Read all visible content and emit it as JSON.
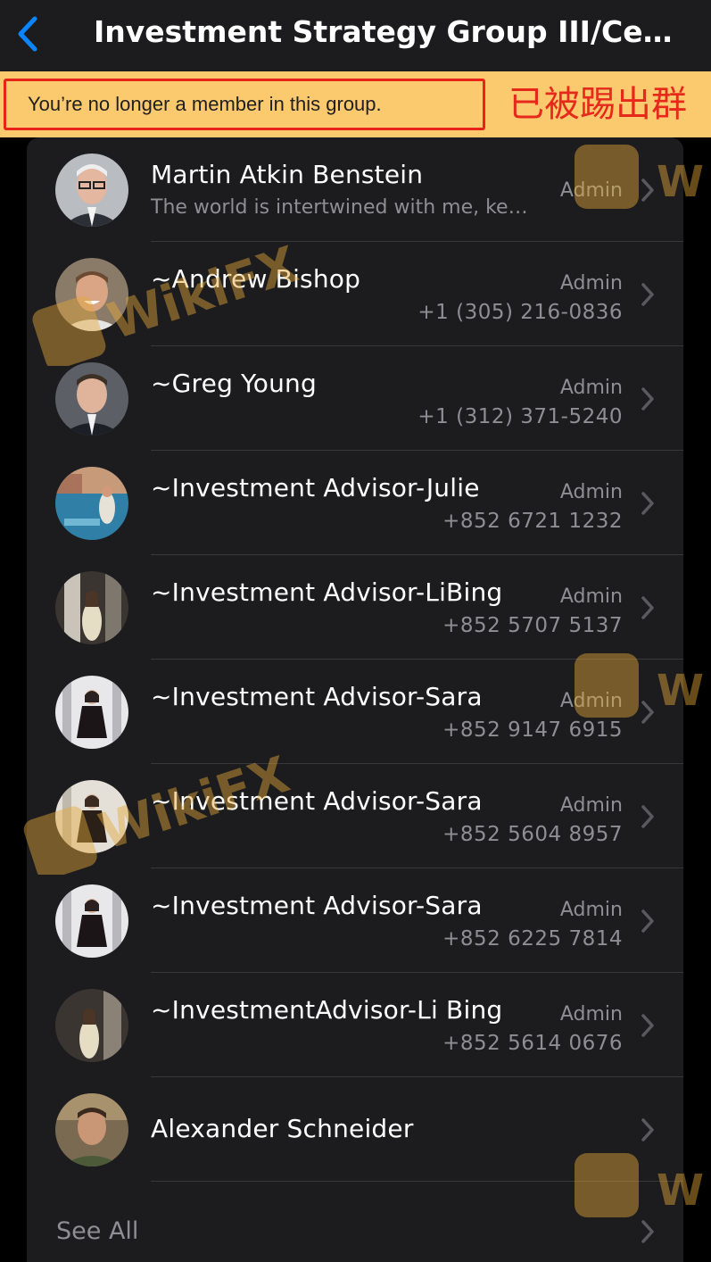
{
  "nav": {
    "title": "Investment Strategy Group III/Cente…"
  },
  "banner": {
    "notice": "You’re no longer a member in this group.",
    "annotation": "已被踢出群"
  },
  "members": [
    {
      "name": "Martin Atkin Benstein",
      "role": "Admin",
      "subtitle": "The world is intertwined with me, ke…"
    },
    {
      "name": "~Andrew Bishop",
      "role": "Admin",
      "phone": "+1 (305) 216-0836"
    },
    {
      "name": "~Greg Young",
      "role": "Admin",
      "phone": "+1 (312) 371-5240"
    },
    {
      "name": "~Investment Advisor-Julie",
      "role": "Admin",
      "phone": "+852 6721 1232"
    },
    {
      "name": "~Investment Advisor-LiBing",
      "role": "Admin",
      "phone": "+852 5707 5137"
    },
    {
      "name": "~Investment Advisor-Sara",
      "role": "Admin",
      "phone": "+852 9147 6915"
    },
    {
      "name": "~Investment Advisor-Sara",
      "role": "Admin",
      "phone": "+852 5604 8957"
    },
    {
      "name": "~Investment Advisor-Sara",
      "role": "Admin",
      "phone": "+852 6225 7814"
    },
    {
      "name": "~InvestmentAdvisor-Li Bing",
      "role": "Admin",
      "phone": "+852 5614 0676"
    },
    {
      "name": "Alexander Schneider"
    }
  ],
  "see_all": "See All",
  "watermark": "WikiFX",
  "colors": {
    "accent": "#0a84ff",
    "banner": "#fbc96e",
    "alert": "#e8231a"
  }
}
